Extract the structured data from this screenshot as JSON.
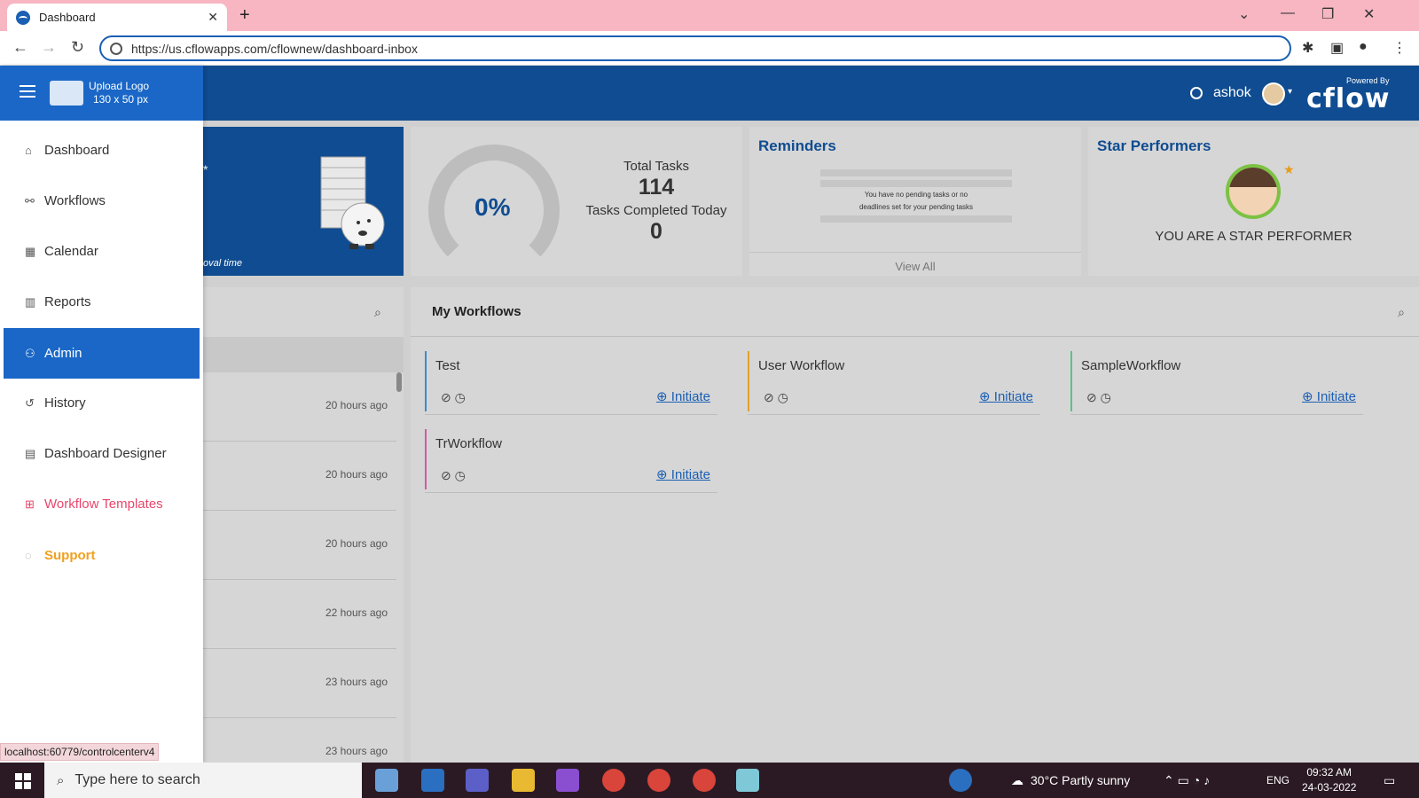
{
  "browser": {
    "tab_title": "Dashboard",
    "tab_close": "✕",
    "new_tab": "+",
    "url": "https://us.cflowapps.com/cflownew/dashboard-inbox",
    "win_min": "—",
    "win_restore": "❐",
    "win_close": "✕",
    "tab_dropdown": "⌄"
  },
  "header": {
    "username": "ashok",
    "powered_by": "Powered By",
    "brand": "cflow"
  },
  "sidebar": {
    "logo_line1": "Upload Logo",
    "logo_line2": "130 x 50 px",
    "items": [
      {
        "label": "Dashboard",
        "icon": "home-icon"
      },
      {
        "label": "Workflows",
        "icon": "workflow-icon"
      },
      {
        "label": "Calendar",
        "icon": "calendar-icon"
      },
      {
        "label": "Reports",
        "icon": "chart-icon"
      },
      {
        "label": "Admin",
        "icon": "admin-icon",
        "active": true
      },
      {
        "label": "History",
        "icon": "history-icon"
      },
      {
        "label": "Dashboard Designer",
        "icon": "designer-icon"
      },
      {
        "label": "Workflow Templates",
        "icon": "templates-icon"
      },
      {
        "label": "Support",
        "icon": "support-icon"
      }
    ]
  },
  "cards": {
    "approval_star": "*",
    "approval_foot": "oval time",
    "gauge_pct": "0%",
    "total_tasks_label": "Total Tasks",
    "total_tasks_value": "114",
    "completed_label": "Tasks Completed Today",
    "completed_value": "0",
    "reminders_title": "Reminders",
    "reminders_text1": "You have no pending tasks or no",
    "reminders_text2": "deadlines set for your pending tasks",
    "view_all": "View All",
    "star_title": "Star Performers",
    "star_text": "YOU ARE A STAR PERFORMER"
  },
  "inbox": {
    "times": [
      "20 hours ago",
      "20 hours ago",
      "20 hours ago",
      "22 hours ago",
      "23 hours ago",
      "23 hours ago"
    ]
  },
  "workflows": {
    "title": "My Workflows",
    "initiate_label": "Initiate",
    "items": [
      {
        "name": "Test",
        "color": "#3a8ad6"
      },
      {
        "name": "User Workflow",
        "color": "#e0a030"
      },
      {
        "name": "SampleWorkflow",
        "color": "#5cc08a"
      },
      {
        "name": "TrWorkflow",
        "color": "#d05aa8"
      }
    ]
  },
  "status_url": "localhost:60779/controlcenterv4",
  "taskbar": {
    "search_placeholder": "Type here to search",
    "weather": "30°C  Partly sunny",
    "lang": "ENG",
    "time": "09:32 AM",
    "date": "24-03-2022"
  }
}
